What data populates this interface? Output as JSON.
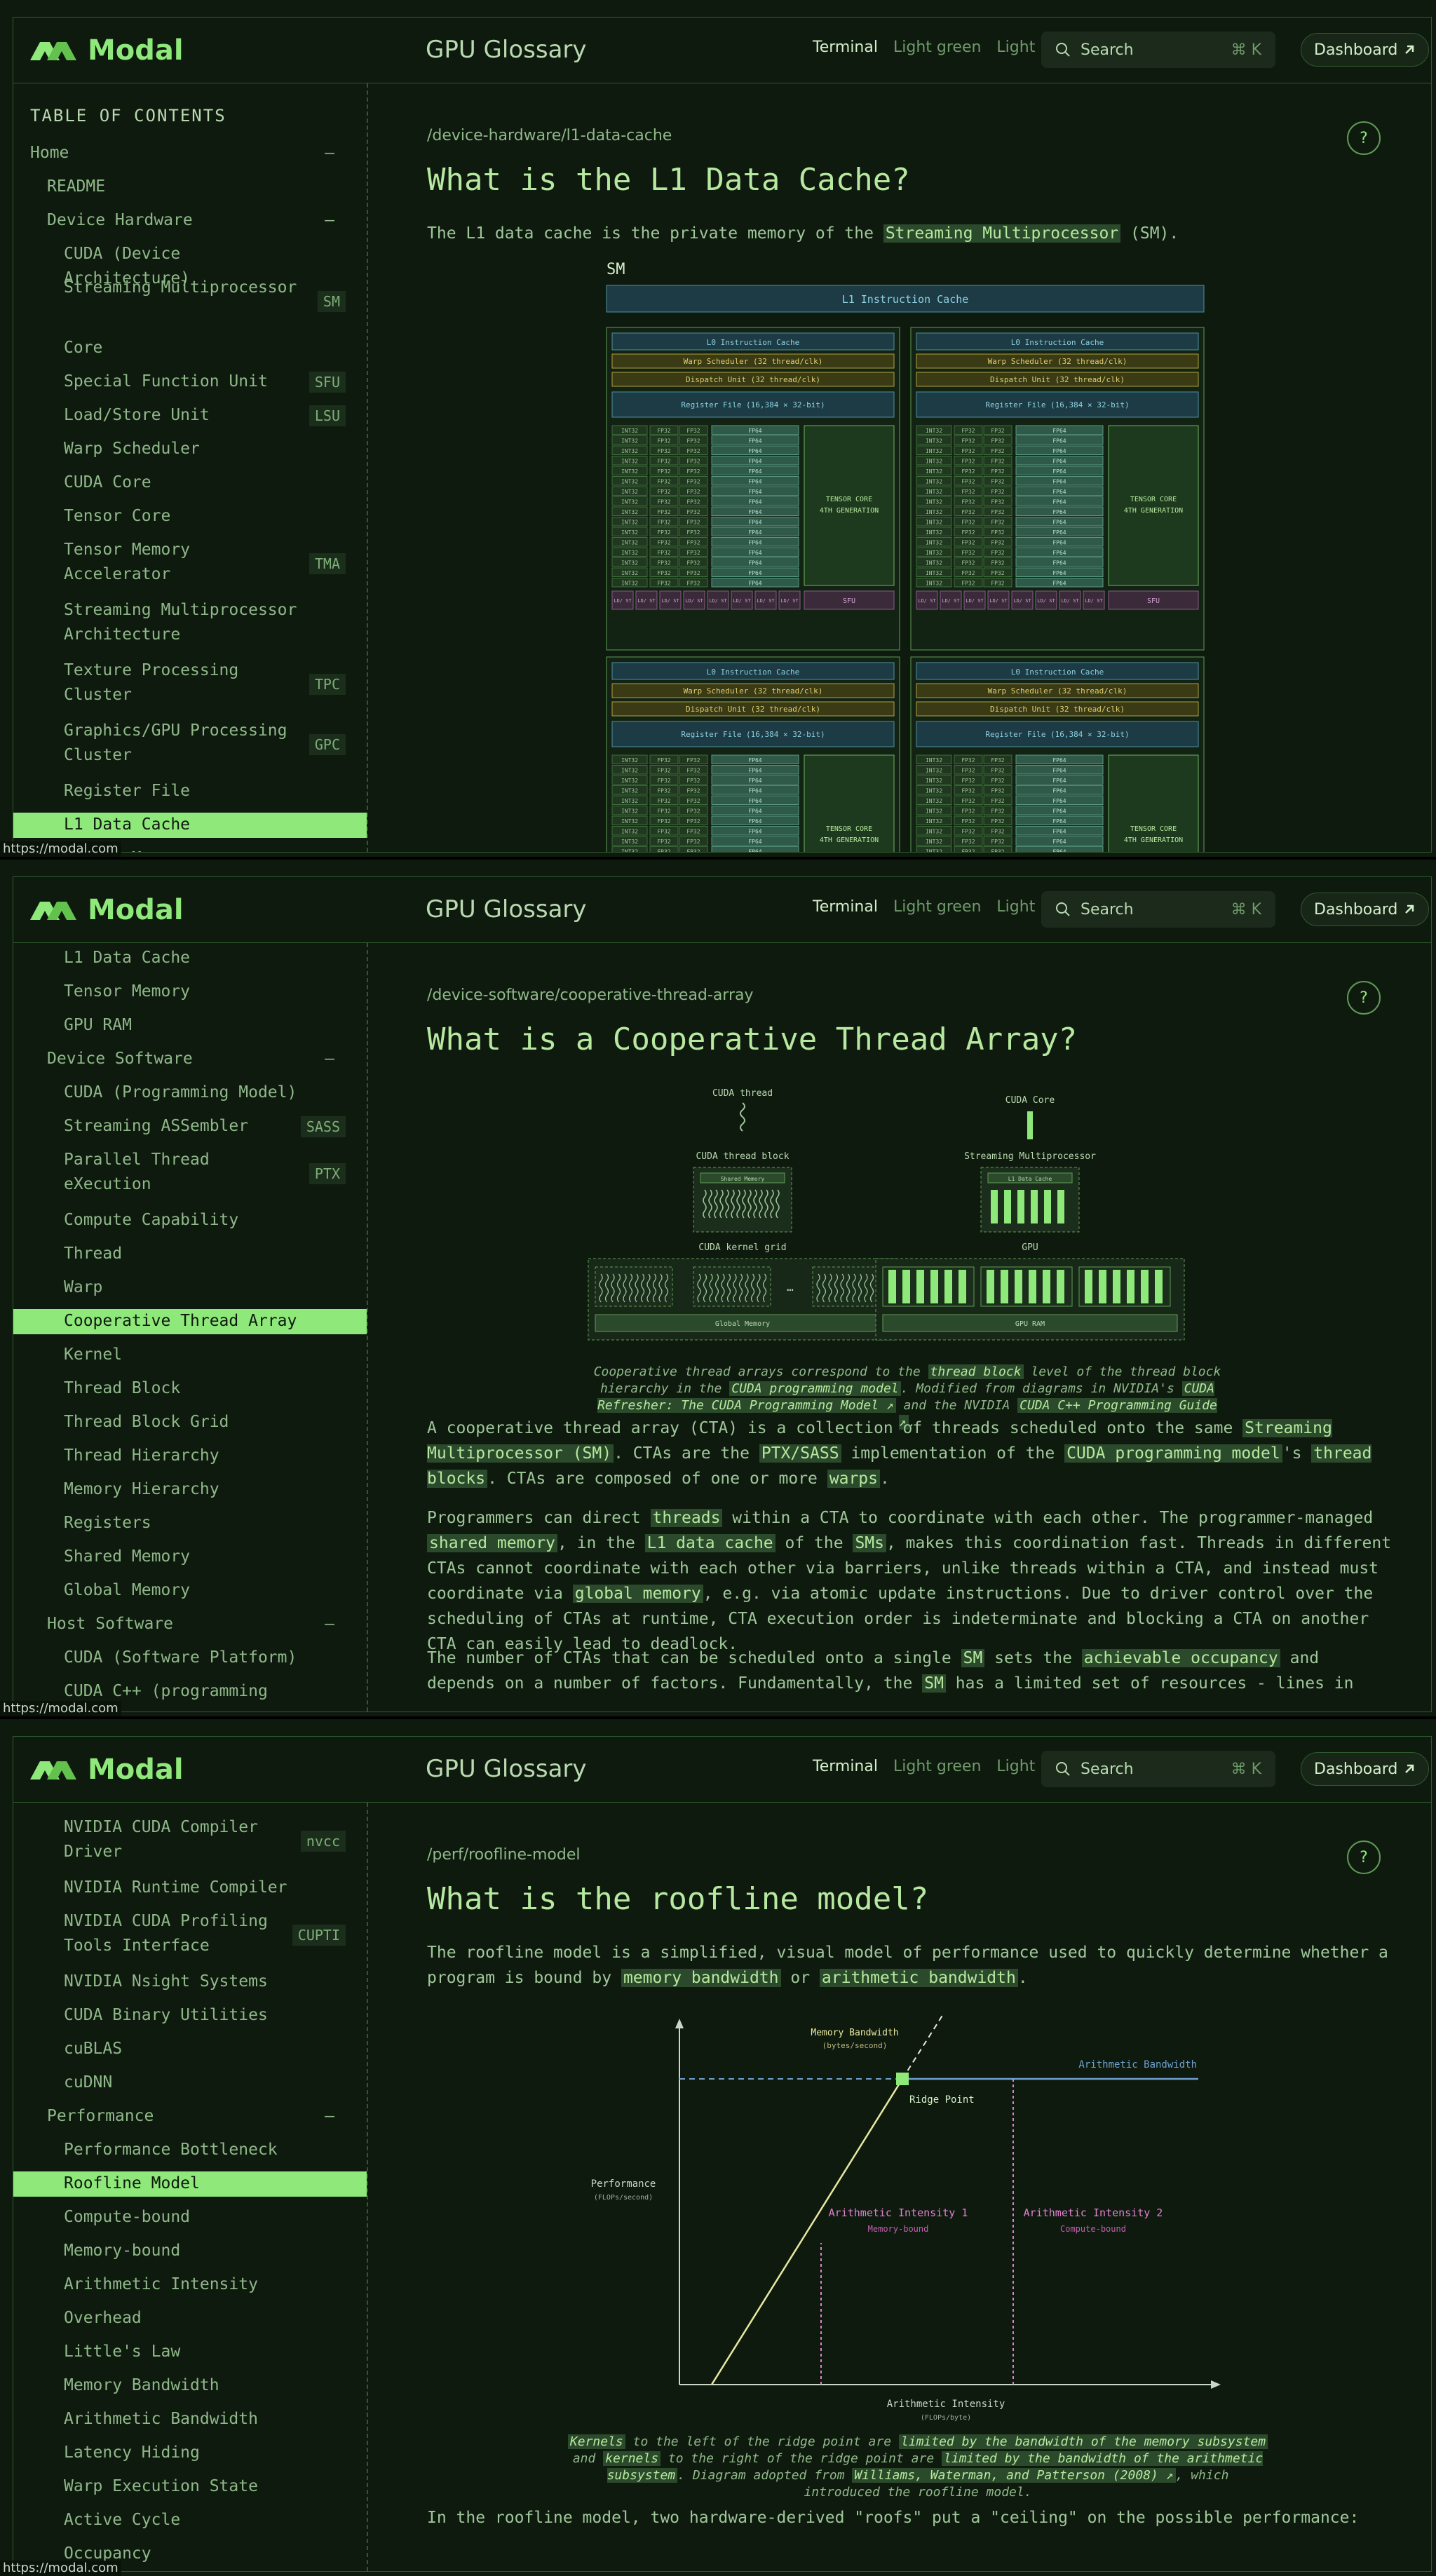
{
  "common": {
    "logo_text": "Modal",
    "site_title": "GPU Glossary",
    "themes": [
      "Terminal",
      "Light green",
      "Light"
    ],
    "search_placeholder": "Search",
    "search_shortcut": "⌘ K",
    "dashboard_label": "Dashboard",
    "status_url": "https://modal.com",
    "toc_title": "TABLE OF CONTENTS",
    "help_label": "?"
  },
  "colors": {
    "accent": "#8fe87a",
    "background": "#0f1a0f",
    "border": "#2d5a2d"
  },
  "icons": [
    "modal-logo-icon",
    "search-icon",
    "arrow-up-right-icon",
    "minus-icon",
    "help-icon"
  ],
  "shot1": {
    "nav": [
      {
        "label": "Home",
        "level": 1,
        "toggle": "–"
      },
      {
        "label": "README",
        "level": 2
      },
      {
        "label": "Device Hardware",
        "level": 2,
        "toggle": "–"
      },
      {
        "label": "CUDA (Device Architecture)",
        "level": 3
      },
      {
        "label": "Streaming Multiprocessor",
        "level": 3,
        "abbr": "SM"
      },
      {
        "label": "Core",
        "level": 3
      },
      {
        "label": "Special Function Unit",
        "level": 3,
        "abbr": "SFU"
      },
      {
        "label": "Load/Store Unit",
        "level": 3,
        "abbr": "LSU"
      },
      {
        "label": "Warp Scheduler",
        "level": 3
      },
      {
        "label": "CUDA Core",
        "level": 3
      },
      {
        "label": "Tensor Core",
        "level": 3
      },
      {
        "label": "Tensor Memory Accelerator",
        "level": 3,
        "abbr": "TMA"
      },
      {
        "label": "Streaming Multiprocessor Architecture",
        "level": 3
      },
      {
        "label": "Texture Processing Cluster",
        "level": 3,
        "abbr": "TPC"
      },
      {
        "label": "Graphics/GPU Processing Cluster",
        "level": 3,
        "abbr": "GPC"
      },
      {
        "label": "Register File",
        "level": 3
      },
      {
        "label": "L1 Data Cache",
        "level": 3,
        "active": true
      },
      {
        "label": "Tensor Memory",
        "level": 3
      }
    ],
    "path": "/device-hardware/l1-data-cache",
    "title": "What is the L1 Data Cache?",
    "intro_pre": "The L1 data cache is the private memory of the ",
    "intro_link": "Streaming Multiprocessor",
    "intro_post": " (SM).",
    "diagram": {
      "sm_label": "SM",
      "l1_instruction_cache": "L1 Instruction Cache",
      "l0_instruction_cache": "L0 Instruction Cache",
      "warp_scheduler": "Warp Scheduler (32 thread/clk)",
      "dispatch_unit": "Dispatch Unit (32 thread/clk)",
      "register_file": "Register File (16,384 × 32-bit)",
      "int32": "INT32",
      "fp32": "FP32",
      "fp64": "FP64",
      "tensor_core_1": "TENSOR CORE",
      "tensor_core_2": "4TH GENERATION",
      "ldst": "LD/ ST",
      "sfu": "SFU"
    }
  },
  "shot2": {
    "nav": [
      {
        "label": "L1 Data Cache",
        "level": 3
      },
      {
        "label": "Tensor Memory",
        "level": 3
      },
      {
        "label": "GPU RAM",
        "level": 3
      },
      {
        "label": "Device Software",
        "level": 2,
        "toggle": "–"
      },
      {
        "label": "CUDA (Programming Model)",
        "level": 3
      },
      {
        "label": "Streaming ASSembler",
        "level": 3,
        "abbr": "SASS"
      },
      {
        "label": "Parallel Thread eXecution",
        "level": 3,
        "abbr": "PTX"
      },
      {
        "label": "Compute Capability",
        "level": 3
      },
      {
        "label": "Thread",
        "level": 3
      },
      {
        "label": "Warp",
        "level": 3
      },
      {
        "label": "Cooperative Thread Array",
        "level": 3,
        "active": true
      },
      {
        "label": "Kernel",
        "level": 3
      },
      {
        "label": "Thread Block",
        "level": 3
      },
      {
        "label": "Thread Block Grid",
        "level": 3
      },
      {
        "label": "Thread Hierarchy",
        "level": 3
      },
      {
        "label": "Memory Hierarchy",
        "level": 3
      },
      {
        "label": "Registers",
        "level": 3
      },
      {
        "label": "Shared Memory",
        "level": 3
      },
      {
        "label": "Global Memory",
        "level": 3
      },
      {
        "label": "Host Software",
        "level": 2,
        "toggle": "–"
      },
      {
        "label": "CUDA (Software Platform)",
        "level": 3
      },
      {
        "label": "CUDA C++ (programming",
        "level": 3
      }
    ],
    "path": "/device-software/cooperative-thread-array",
    "title": "What is a Cooperative Thread Array?",
    "diagram": {
      "cuda_thread": "CUDA thread",
      "cuda_core": "CUDA Core",
      "cuda_thread_block": "CUDA thread block",
      "streaming_multiprocessor": "Streaming Multiprocessor",
      "shared_memory": "Shared Memory",
      "l1_data_cache": "L1 Data Cache",
      "cuda_kernel_grid": "CUDA kernel grid",
      "gpu": "GPU",
      "global_memory": "Global Memory",
      "gpu_ram": "GPU RAM",
      "ellipsis": "…"
    },
    "caption": [
      "Cooperative thread arrays correspond to the ",
      "thread block",
      " level of the thread block hierarchy in the ",
      "CUDA programming model",
      ". Modified from diagrams in NVIDIA's ",
      "CUDA Refresher: The CUDA Programming Model ↗",
      " and the NVIDIA ",
      "CUDA C++ Programming Guide ↗",
      "."
    ],
    "p1": [
      "A cooperative thread array (CTA) is a collection of threads scheduled onto the same ",
      "Streaming Multiprocessor (SM)",
      ". CTAs are the ",
      "PTX/SASS",
      " implementation of the ",
      "CUDA programming model",
      "'s ",
      "thread blocks",
      ". CTAs are composed of one or more ",
      "warps",
      "."
    ],
    "p2": [
      "Programmers can direct ",
      "threads",
      " within a CTA to coordinate with each other. The programmer-managed ",
      "shared memory",
      ", in the ",
      "L1 data cache",
      " of the ",
      "SMs",
      ", makes this coordination fast. Threads in different CTAs cannot coordinate with each other via barriers, unlike threads within a CTA, and instead must coordinate via ",
      "global memory",
      ", e.g. via atomic update instructions. Due to driver control over the scheduling of CTAs at runtime, CTA execution order is indeterminate and blocking a CTA on another CTA can easily lead to deadlock."
    ],
    "p3": [
      "The number of CTAs that can be scheduled onto a single ",
      "SM",
      " sets the ",
      "achievable occupancy",
      " and depends on a number of factors. Fundamentally, the ",
      "SM",
      " has a limited set of resources - lines in"
    ]
  },
  "shot3": {
    "nav": [
      {
        "label": "NVIDIA CUDA Compiler Driver",
        "level": 3,
        "abbr": "nvcc"
      },
      {
        "label": "NVIDIA Runtime Compiler",
        "level": 3
      },
      {
        "label": "NVIDIA CUDA Profiling Tools Interface",
        "level": 3,
        "abbr": "CUPTI"
      },
      {
        "label": "NVIDIA Nsight Systems",
        "level": 3
      },
      {
        "label": "CUDA Binary Utilities",
        "level": 3
      },
      {
        "label": "cuBLAS",
        "level": 3
      },
      {
        "label": "cuDNN",
        "level": 3
      },
      {
        "label": "Performance",
        "level": 2,
        "toggle": "–"
      },
      {
        "label": "Performance Bottleneck",
        "level": 3
      },
      {
        "label": "Roofline Model",
        "level": 3,
        "active": true
      },
      {
        "label": "Compute-bound",
        "level": 3
      },
      {
        "label": "Memory-bound",
        "level": 3
      },
      {
        "label": "Arithmetic Intensity",
        "level": 3
      },
      {
        "label": "Overhead",
        "level": 3
      },
      {
        "label": "Little's Law",
        "level": 3
      },
      {
        "label": "Memory Bandwidth",
        "level": 3
      },
      {
        "label": "Arithmetic Bandwidth",
        "level": 3
      },
      {
        "label": "Latency Hiding",
        "level": 3
      },
      {
        "label": "Warp Execution State",
        "level": 3
      },
      {
        "label": "Active Cycle",
        "level": 3
      },
      {
        "label": "Occupancy",
        "level": 3
      }
    ],
    "path": "/perf/roofline-model",
    "title": "What is the roofline model?",
    "intro": [
      "The roofline model is a simplified, visual model of performance used to quickly determine whether a program is bound by ",
      "memory bandwidth",
      " or ",
      "arithmetic bandwidth",
      "."
    ],
    "diagram": {
      "memory_bandwidth": "Memory Bandwidth",
      "memory_bandwidth_unit": "(bytes/second)",
      "arithmetic_bandwidth": "Arithmetic Bandwidth",
      "ridge_point": "Ridge Point",
      "performance": "Performance",
      "performance_unit": "(FLOPs/second)",
      "ai1": "Arithmetic Intensity 1",
      "ai1_sub": "Memory-bound",
      "ai2": "Arithmetic Intensity 2",
      "ai2_sub": "Compute-bound",
      "x_axis": "Arithmetic Intensity",
      "x_axis_unit": "(FLOPs/byte)"
    },
    "caption": [
      "Kernels",
      " to the left of the ridge point are ",
      "limited by the bandwidth of the memory subsystem",
      " and ",
      "kernels",
      " to the right of the ridge point are ",
      "limited by the bandwidth of the arithmetic subsystem",
      ". Diagram adopted from ",
      "Williams, Waterman, and Patterson (2008) ↗",
      ", which introduced the roofline model."
    ],
    "closing": "In the roofline model, two hardware-derived \"roofs\" put a \"ceiling\" on the possible performance:"
  }
}
